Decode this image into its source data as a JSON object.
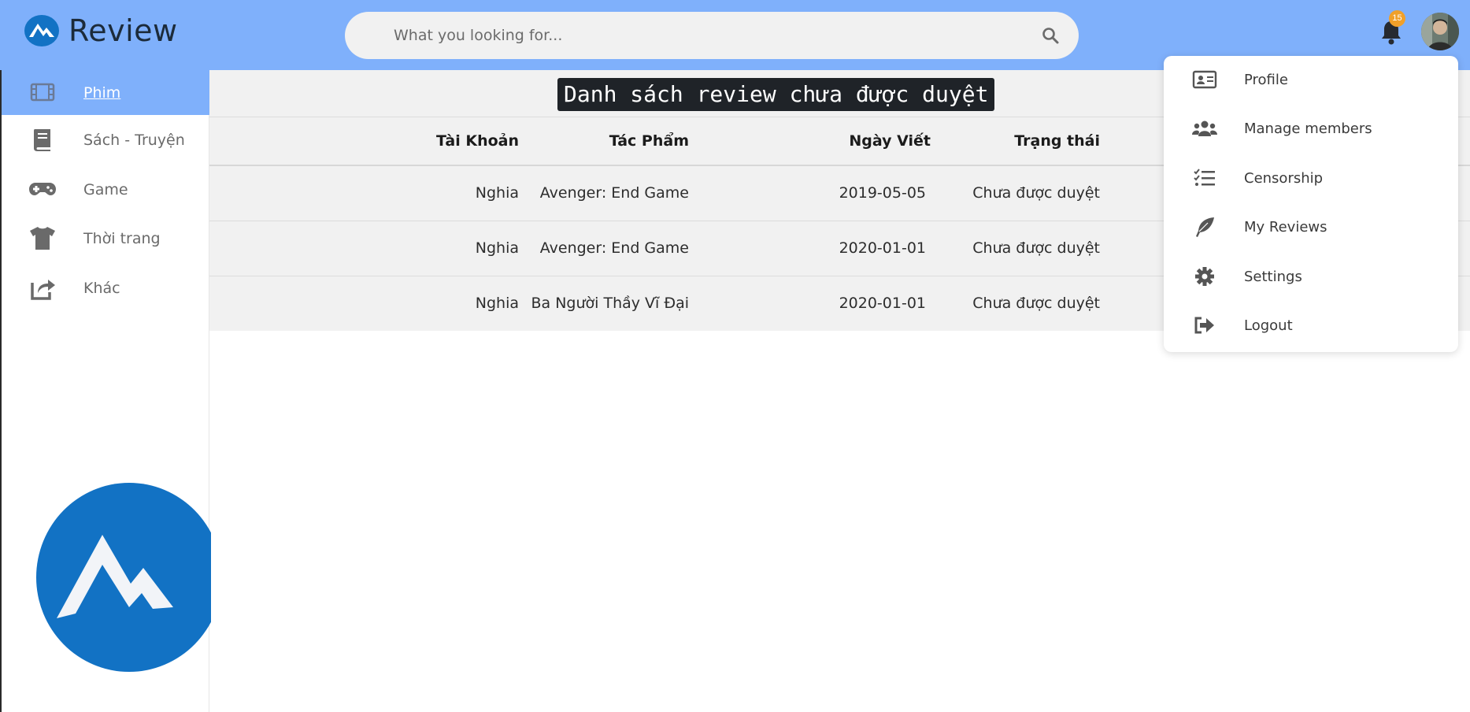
{
  "brand": {
    "name": "Review"
  },
  "search": {
    "placeholder": "What you looking for..."
  },
  "notifications": {
    "count": "15"
  },
  "sidebar": {
    "items": [
      {
        "label": "Phim",
        "icon": "film-icon",
        "active": true
      },
      {
        "label": "Sách - Truyện",
        "icon": "book-icon",
        "active": false
      },
      {
        "label": "Game",
        "icon": "gamepad-icon",
        "active": false
      },
      {
        "label": "Thời trang",
        "icon": "tshirt-icon",
        "active": false
      },
      {
        "label": "Khác",
        "icon": "share-icon",
        "active": false
      }
    ]
  },
  "main": {
    "title": "Danh sách review chưa được duyệt",
    "table": {
      "headers": [
        "Tài Khoản",
        "Tác Phẩm",
        "Ngày Viết",
        "Trạng thái"
      ],
      "rows": [
        [
          "Nghia",
          "Avenger: End Game",
          "2019-05-05",
          "Chưa được duyệt"
        ],
        [
          "Nghia",
          "Avenger: End Game",
          "2020-01-01",
          "Chưa được duyệt"
        ],
        [
          "Nghia",
          "Ba Người Thầy Vĩ Đại",
          "2020-01-01",
          "Chưa được duyệt"
        ]
      ]
    }
  },
  "user_menu": {
    "items": [
      {
        "label": "Profile",
        "icon": "id-card-icon"
      },
      {
        "label": "Manage members",
        "icon": "users-icon"
      },
      {
        "label": "Censorship",
        "icon": "checklist-icon"
      },
      {
        "label": "My Reviews",
        "icon": "feather-icon"
      },
      {
        "label": "Settings",
        "icon": "gear-icon"
      },
      {
        "label": "Logout",
        "icon": "sign-out-icon"
      }
    ]
  },
  "colors": {
    "header_bg": "#7fb0fb",
    "active_nav_bg": "#7fb0fb",
    "badge": "#f0a02a",
    "brand_blue": "#1272c4",
    "title_bg": "#1f2328"
  }
}
